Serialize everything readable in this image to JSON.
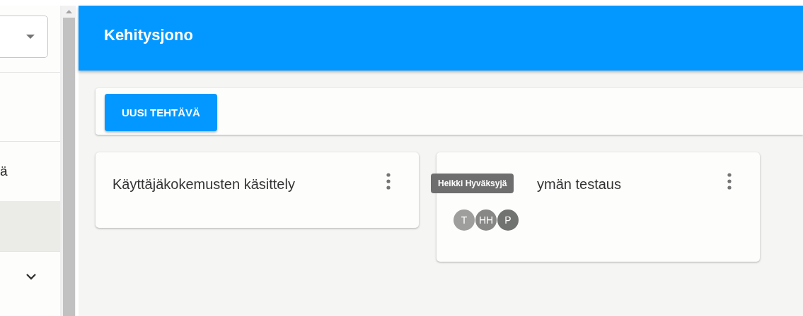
{
  "sidebar": {
    "items": [
      {
        "kind": "blank",
        "selected": false
      },
      {
        "kind": "text",
        "label": "ä",
        "selected": false
      },
      {
        "kind": "blank",
        "selected": true
      },
      {
        "kind": "expander",
        "expanded": false
      }
    ]
  },
  "header": {
    "title": "Kehitysjono"
  },
  "toolbar": {
    "button": "UUSI TEHTÄVÄ"
  },
  "cards": [
    {
      "title": "Käyttäjäkokemusten käsittely"
    },
    {
      "title": "ymän testaus",
      "avatars": [
        {
          "initials": "T",
          "color": "#9e9f9d"
        },
        {
          "initials": "HH",
          "color": "#878886"
        },
        {
          "initials": "P",
          "color": "#717370"
        }
      ],
      "tooltip": "Heikki Hyväksyjä"
    }
  ]
}
